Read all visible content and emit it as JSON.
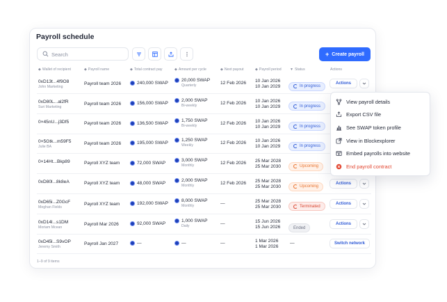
{
  "title": "Payroll schedule",
  "search": {
    "placeholder": "Search"
  },
  "create_label": "Create payroll",
  "columns": [
    "Wallet of recipient",
    "Payroll name",
    "Total contract pay",
    "Amount per cycle",
    "Next payout",
    "Payroll period",
    "Status",
    "Actions"
  ],
  "rows": [
    {
      "wallet": "0xD13t...4f9O8",
      "recipient": "John Marketing",
      "payroll": "Payroll team 2026",
      "total": "240,000 SWAP",
      "cycle_amount": "20,000 SWAP",
      "cycle": "Quarterly",
      "next": "12 Feb 2026",
      "period_start": "10 Jan 2026",
      "period_end": "10 Jan 2029",
      "status": "In progress",
      "status_type": "progress",
      "action": "Actions"
    },
    {
      "wallet": "0xD80L...al2fR",
      "recipient": "Suri Marketing",
      "payroll": "Payroll team 2026",
      "total": "156,000 SWAP",
      "cycle_amount": "2,000 SWAP",
      "cycle": "Bi-weekly",
      "next": "12 Feb 2026",
      "period_start": "10 Jan 2026",
      "period_end": "10 Jan 2029",
      "status": "In progress",
      "status_type": "progress",
      "action": ""
    },
    {
      "wallet": "0×45nU...j3Df5",
      "recipient": "",
      "payroll": "Payroll team 2026",
      "total": "136,500 SWAP",
      "cycle_amount": "1,750 SWAP",
      "cycle": "Bi-weekly",
      "next": "12 Feb 2026",
      "period_start": "10 Jan 2026",
      "period_end": "10 Jan 2029",
      "status": "In progress",
      "status_type": "progress",
      "action": ""
    },
    {
      "wallet": "0×5Gtk...m59F5",
      "recipient": "Julie BA",
      "payroll": "Payroll team 2026",
      "total": "195,000 SWAP",
      "cycle_amount": "1,250 SWAP",
      "cycle": "Weekly",
      "next": "12 Feb 2026",
      "period_start": "10 Jan 2026",
      "period_end": "10 Jan 2029",
      "status": "In progress",
      "status_type": "progress",
      "action": ""
    },
    {
      "wallet": "0×14Ht...Bkp89",
      "recipient": "",
      "payroll": "Payroll XYZ team",
      "total": "72,000 SWAP",
      "cycle_amount": "3,000 SWAP",
      "cycle": "Monthly",
      "next": "12 Feb 2026",
      "period_start": "25 Mar 2028",
      "period_end": "25 Mar 2030",
      "status": "Upcoming",
      "status_type": "upcoming",
      "action": ""
    },
    {
      "wallet": "0xD80l...8k8eA",
      "recipient": "",
      "payroll": "Payroll XYZ team",
      "total": "48,000 SWAP",
      "cycle_amount": "2,000 SWAP",
      "cycle": "Monthly",
      "next": "12 Feb 2026",
      "period_start": "25 Mar 2028",
      "period_end": "25 Mar 2030",
      "status": "Upcoming",
      "status_type": "upcoming",
      "action": "Actions"
    },
    {
      "wallet": "0xD65i...Z0GcF",
      "recipient": "Meghan Fields",
      "payroll": "Payroll XYZ team",
      "total": "192,000 SWAP",
      "cycle_amount": "8,000 SWAP",
      "cycle": "Monthly",
      "next": "—",
      "period_start": "25 Mar 2028",
      "period_end": "25 Mar 2030",
      "status": "Terminated",
      "status_type": "terminated",
      "action": "Actions"
    },
    {
      "wallet": "0xD14l...s1DM",
      "recipient": "Moriam Mcean",
      "payroll": "Payroll Mar 2026",
      "total": "92,000 SWAP",
      "cycle_amount": "1,000 SWAP",
      "cycle": "Daily",
      "next": "—",
      "period_start": "15 Jun 2026",
      "period_end": "15 Jun 2026",
      "status": "Ended",
      "status_type": "ended",
      "action": "Actions"
    },
    {
      "wallet": "0xD45l...S9vOP",
      "recipient": "Jeremy Smith",
      "payroll": "Payroll Jan 2027",
      "total": "—",
      "cycle_amount": "—",
      "cycle": "",
      "next": "—",
      "period_start": "1 Mar 2026",
      "period_end": "1 Mar 2026",
      "status": "—",
      "status_type": "none",
      "action": "Switch network"
    }
  ],
  "footer": "1–9 of 9 items",
  "menu": [
    {
      "label": "View payroll details",
      "icon": "branch-icon"
    },
    {
      "label": "Export CSV file",
      "icon": "export-icon"
    },
    {
      "label": "See SWAP token profile",
      "icon": "chart-icon"
    },
    {
      "label": "View in Blockexplorer",
      "icon": "external-link-icon"
    },
    {
      "label": "Embed payrolls into website",
      "icon": "embed-icon"
    },
    {
      "label": "End payroll contract",
      "icon": "cancel-icon"
    }
  ],
  "colors": {
    "accent": "#2f6bff",
    "danger": "#e2452f",
    "upcoming": "#e8702a"
  }
}
